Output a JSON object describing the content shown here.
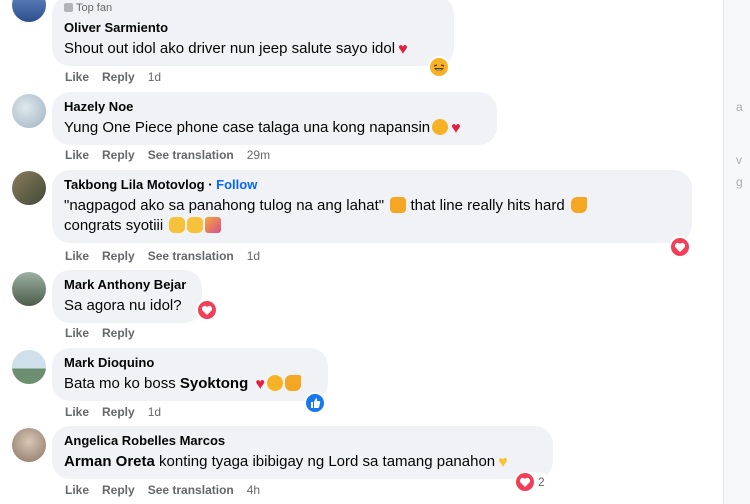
{
  "actions": {
    "like": "Like",
    "reply": "Reply",
    "see_translation": "See translation"
  },
  "comments": [
    {
      "badge": "Top fan",
      "name": "Oliver Sarmiento",
      "text": "Shout out idol ako driver nun jeep salute sayo idol",
      "time": "1d"
    },
    {
      "name": "Hazely Noe",
      "text": "Yung One Piece phone case talaga una kong napansin",
      "time": "29m"
    },
    {
      "name": "Takbong Lila Motovlog",
      "follow": "Follow",
      "text_line1": "\"nagpagod ako sa panahong tulog na ang lahat\"",
      "text_line1b": "that line really hits hard",
      "text_line2": "congrats syotiii",
      "time": "1d"
    },
    {
      "name": "Mark Anthony Bejar",
      "text": "Sa agora nu idol?",
      "time": ""
    },
    {
      "name": "Mark Dioquino",
      "text": "Bata mo ko boss",
      "mention": "Syoktong",
      "time": "1d"
    },
    {
      "name": "Angelica Robelles Marcos",
      "mention": "Arman Oreta",
      "text": "konting tyaga ibibigay ng Lord sa tamang panahon",
      "time": "4h",
      "reaction_count": "2"
    }
  ],
  "colors": {
    "bubble": "#f0f2f5",
    "meta": "#65676b",
    "link": "#0866ff",
    "love": "#f33e58",
    "like": "#1877f2"
  },
  "icons": [
    "top-fan-icon",
    "heart-emoji",
    "laughing-emoji",
    "love-reaction-icon",
    "like-reaction-icon",
    "fist-emoji",
    "flexed-biceps-emoji",
    "clapping-emoji",
    "party-popper-emoji",
    "sunglasses-emoji",
    "yellow-heart-emoji"
  ]
}
